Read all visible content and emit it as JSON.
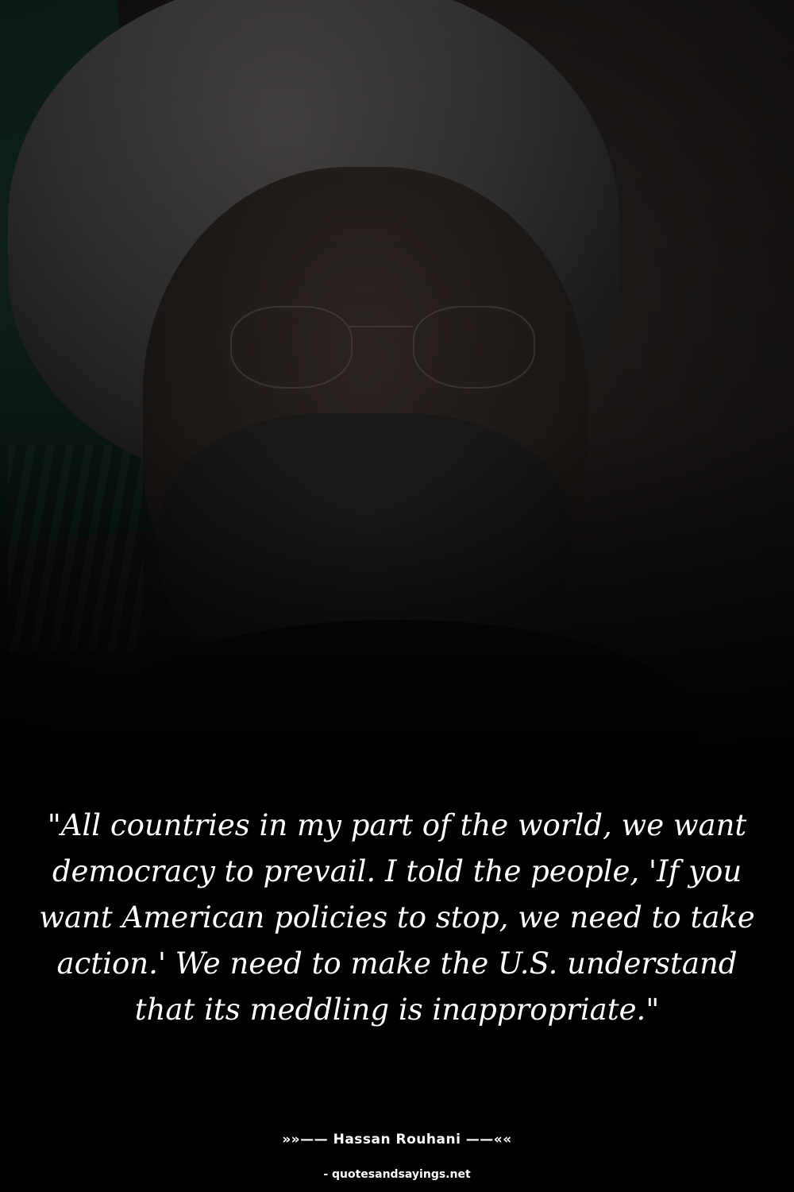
{
  "quote": {
    "text": "\"All countries in my part of the world, we want democracy to prevail. I told the people, 'If you want American policies to stop, we need to take action.' We need to make the U.S. understand that its meddling is inappropriate.\""
  },
  "attribution": {
    "author_line": "»»—— Hassan Rouhani ——««"
  },
  "footer": {
    "source": "- quotesandsayings.net"
  },
  "colors": {
    "background": "#000000",
    "text": "#ffffff",
    "flag_green": "#173a2d"
  }
}
